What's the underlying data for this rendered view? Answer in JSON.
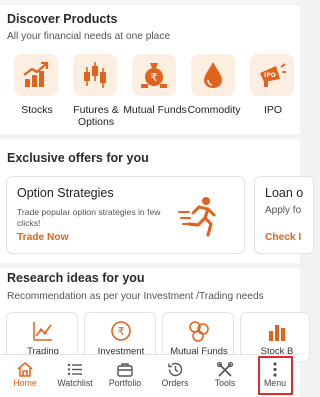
{
  "accent_color": "#e0641d",
  "discover": {
    "title": "Discover Products",
    "subtitle": "All your financial needs at one place",
    "products": [
      {
        "label": "Stocks",
        "icon": "stocks-chart-icon"
      },
      {
        "label": "Futures & Options",
        "icon": "candlestick-icon"
      },
      {
        "label": "Mutual Funds",
        "icon": "money-bag-icon"
      },
      {
        "label": "Commodity",
        "icon": "oil-drop-icon"
      },
      {
        "label": "IPO",
        "icon": "megaphone-icon"
      }
    ]
  },
  "offers": {
    "title": "Exclusive offers for you",
    "cards": [
      {
        "title": "Option Strategies",
        "description": "Trade popular option strategies in few clicks!",
        "link": "Trade Now",
        "icon": "running-man-icon"
      },
      {
        "title": "Loan o",
        "description": "Apply fo",
        "link": "Check I"
      }
    ]
  },
  "research": {
    "title": "Research ideas for you",
    "subtitle": "Recommendation as per your Investment /Trading needs",
    "cards": [
      {
        "label": "Trading",
        "icon": "trend-chart-icon"
      },
      {
        "label": "Investment",
        "icon": "rupee-coin-icon"
      },
      {
        "label": "Mutual Funds",
        "icon": "coins-icon"
      },
      {
        "label": "Stock B",
        "icon": "bar-chart-icon"
      }
    ]
  },
  "nav": {
    "items": [
      {
        "label": "Home",
        "icon": "home-icon",
        "active": true
      },
      {
        "label": "Watchlist",
        "icon": "list-icon",
        "active": false
      },
      {
        "label": "Portfolio",
        "icon": "briefcase-icon",
        "active": false
      },
      {
        "label": "Orders",
        "icon": "history-icon",
        "active": false
      },
      {
        "label": "Tools",
        "icon": "tools-icon",
        "active": false
      },
      {
        "label": "Menu",
        "icon": "more-vertical-icon",
        "active": false
      }
    ]
  }
}
